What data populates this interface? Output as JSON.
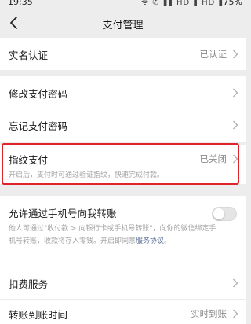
{
  "status_bar": {
    "time": "19:35",
    "signal_icons": "ᯤ ✆ ▮▮ HD ▮ HD ▮",
    "battery": "75%"
  },
  "nav": {
    "back_icon": "chevron-left-icon",
    "title": "支付管理"
  },
  "rows": {
    "real_name": {
      "label": "实名认证",
      "value": "已认证"
    },
    "change_password": {
      "label": "修改支付密码"
    },
    "forgot_password": {
      "label": "忘记支付密码"
    },
    "fingerprint": {
      "label": "指纹支付",
      "value": "已关闭",
      "description": "开启后，支付时可通过验证指纹，快速完成付款。"
    },
    "phone_transfer": {
      "label": "允许通过手机号向我转账",
      "toggle_on": false,
      "description_1": "他人可通过\"收付款 > 向银行卡或手机号转账\"，向你的微信绑定手",
      "description_2": "机号转账，收款将存入零钱。开启即同意",
      "link": "服务协议",
      "description_end": "。"
    },
    "deduction": {
      "label": "扣费服务"
    },
    "arrival_time": {
      "label": "转账到账时间",
      "value": "实时到账"
    }
  },
  "colors": {
    "background": "#ededed",
    "highlight": "#e0232a",
    "link": "#576b95"
  }
}
